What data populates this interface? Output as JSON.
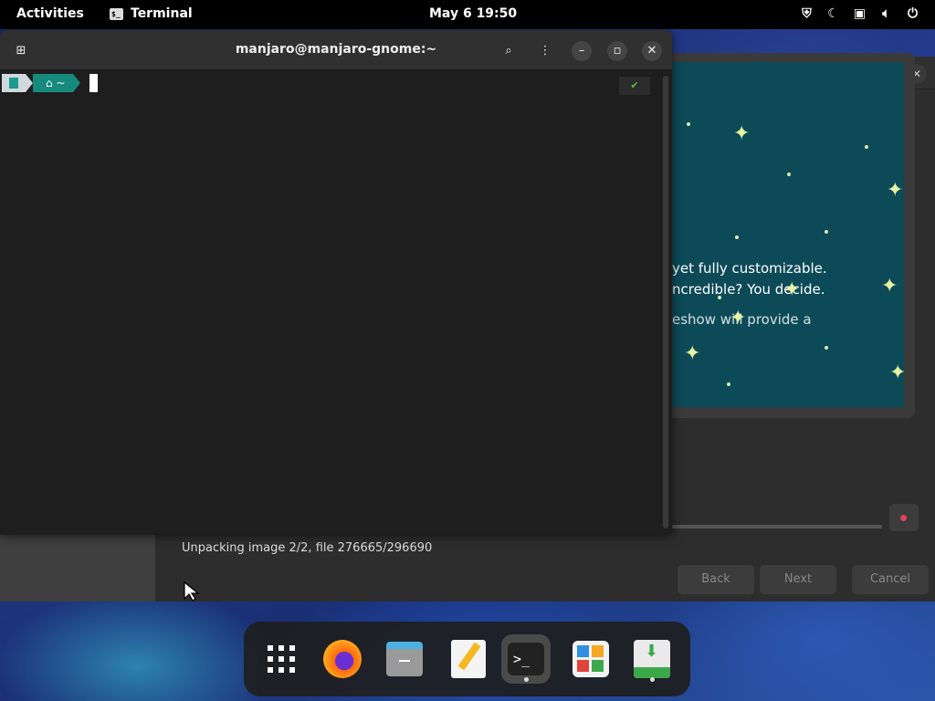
{
  "topbar": {
    "activities": "Activities",
    "app_name": "Terminal",
    "clock": "May 6  19:50",
    "tray_icons": [
      "shield-icon",
      "night-light-icon",
      "display-icon",
      "volume-icon",
      "power-icon"
    ]
  },
  "terminal": {
    "title": "manjaro@manjaro-gnome:~",
    "prompt_dir": "~",
    "status_check": "✔"
  },
  "installer": {
    "slide_line1": "yet fully customizable.",
    "slide_line2": "ncredible? You decide.",
    "slide_line3": "eshow will provide a",
    "status": "Unpacking image 2/2, file 276665/296690",
    "back_label": "Back",
    "next_label": "Next",
    "cancel_label": "Cancel"
  },
  "dock": {
    "items": [
      "app-grid",
      "firefox",
      "files",
      "text-editor",
      "terminal",
      "software",
      "installer"
    ],
    "active": "terminal"
  },
  "colors": {
    "terminal_bg": "#1e1e1e",
    "prompt_teal": "#168a7c",
    "slide_bg": "#0d4a58"
  }
}
